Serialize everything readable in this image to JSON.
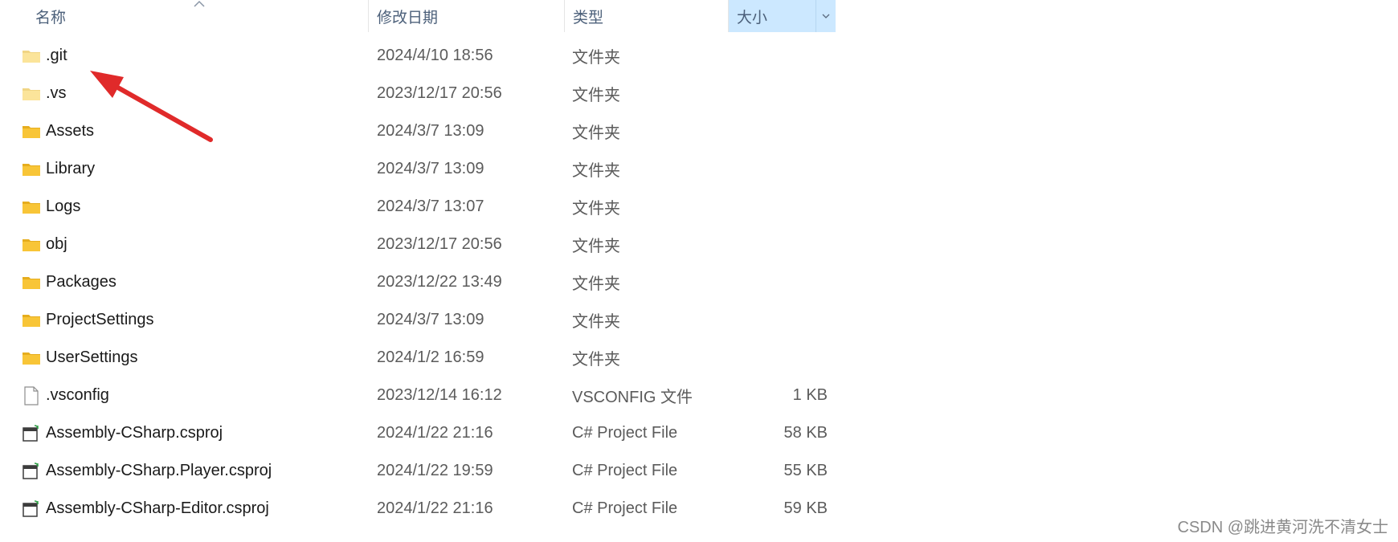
{
  "columns": {
    "name": "名称",
    "date": "修改日期",
    "type": "类型",
    "size": "大小"
  },
  "colors": {
    "folder": "#f8c537",
    "folder_hidden": "#fbe49a",
    "header_active": "#cce8ff",
    "annotation_arrow": "#e02a2a"
  },
  "files": [
    {
      "icon": "folder-hidden-icon",
      "name": ".git",
      "date": "2024/4/10 18:56",
      "type": "文件夹",
      "size": ""
    },
    {
      "icon": "folder-hidden-icon",
      "name": ".vs",
      "date": "2023/12/17 20:56",
      "type": "文件夹",
      "size": ""
    },
    {
      "icon": "folder-icon",
      "name": "Assets",
      "date": "2024/3/7 13:09",
      "type": "文件夹",
      "size": ""
    },
    {
      "icon": "folder-icon",
      "name": "Library",
      "date": "2024/3/7 13:09",
      "type": "文件夹",
      "size": ""
    },
    {
      "icon": "folder-icon",
      "name": "Logs",
      "date": "2024/3/7 13:07",
      "type": "文件夹",
      "size": ""
    },
    {
      "icon": "folder-icon",
      "name": "obj",
      "date": "2023/12/17 20:56",
      "type": "文件夹",
      "size": ""
    },
    {
      "icon": "folder-icon",
      "name": "Packages",
      "date": "2023/12/22 13:49",
      "type": "文件夹",
      "size": ""
    },
    {
      "icon": "folder-icon",
      "name": "ProjectSettings",
      "date": "2024/3/7 13:09",
      "type": "文件夹",
      "size": ""
    },
    {
      "icon": "folder-icon",
      "name": "UserSettings",
      "date": "2024/1/2 16:59",
      "type": "文件夹",
      "size": ""
    },
    {
      "icon": "file-icon",
      "name": ".vsconfig",
      "date": "2023/12/14 16:12",
      "type": "VSCONFIG 文件",
      "size": "1 KB"
    },
    {
      "icon": "csproj-icon",
      "name": "Assembly-CSharp.csproj",
      "date": "2024/1/22 21:16",
      "type": "C# Project File",
      "size": "58 KB"
    },
    {
      "icon": "csproj-icon",
      "name": "Assembly-CSharp.Player.csproj",
      "date": "2024/1/22 19:59",
      "type": "C# Project File",
      "size": "55 KB"
    },
    {
      "icon": "csproj-icon",
      "name": "Assembly-CSharp-Editor.csproj",
      "date": "2024/1/22 21:16",
      "type": "C# Project File",
      "size": "59 KB"
    }
  ],
  "watermark": "CSDN @跳进黄河洗不清女士"
}
